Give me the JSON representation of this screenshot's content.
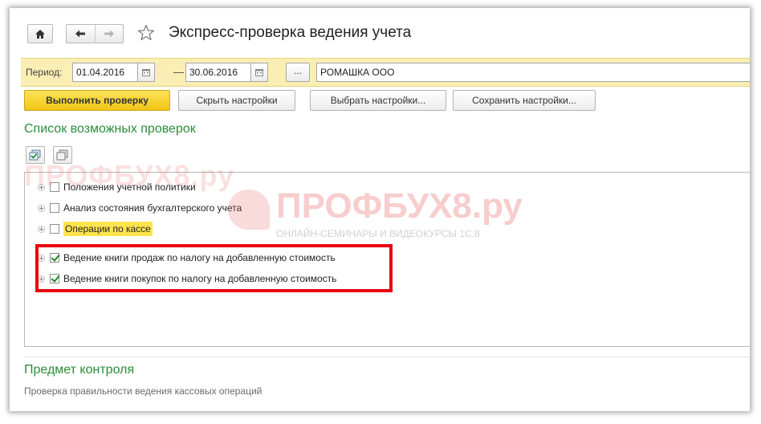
{
  "window": {
    "title": "Экспресс-проверка ведения учета"
  },
  "icons": {
    "home": "home-icon",
    "back": "arrow-left-icon",
    "forward": "arrow-right-icon",
    "favorite": "star-icon",
    "calendar": "calendar-icon",
    "tree_check_all": "check-all-icon",
    "tree_uncheck_all": "uncheck-all-icon"
  },
  "period": {
    "label": "Период:",
    "date_from": "01.04.2016",
    "separator": "—",
    "date_to": "30.06.2016",
    "select_period_label": "...",
    "organization": "РОМАШКА ООО"
  },
  "actions": {
    "run_check": "Выполнить проверку",
    "hide_settings": "Скрыть настройки",
    "choose_settings": "Выбрать настройки...",
    "save_settings": "Сохранить настройки..."
  },
  "checks": {
    "title": "Список возможных проверок",
    "items": [
      {
        "label": "Положения учетной политики",
        "checked": false
      },
      {
        "label": "Анализ состояния бухгалтерского учета",
        "checked": false
      },
      {
        "label": "Операции по кассе",
        "checked": false,
        "highlighted": true
      },
      {
        "label": "Ведение книги продаж по налогу на добавленную стоимость",
        "checked": true
      },
      {
        "label": "Ведение книги покупок по налогу на добавленную стоимость",
        "checked": true
      }
    ]
  },
  "subject": {
    "title": "Предмет контроля",
    "text": "Проверка правильности ведения кассовых операций"
  },
  "watermark": {
    "brand": "ПРОФБУХ8.ру",
    "tagline": "ОНЛАЙН-СЕМИНАРЫ И ВИДЕОКУРСЫ 1С:8"
  },
  "colors": {
    "accent_green": "#2c8c3c",
    "period_bar": "#fbeeb4",
    "primary_button": "#f5d32a",
    "highlight_frame": "#e8000f"
  }
}
